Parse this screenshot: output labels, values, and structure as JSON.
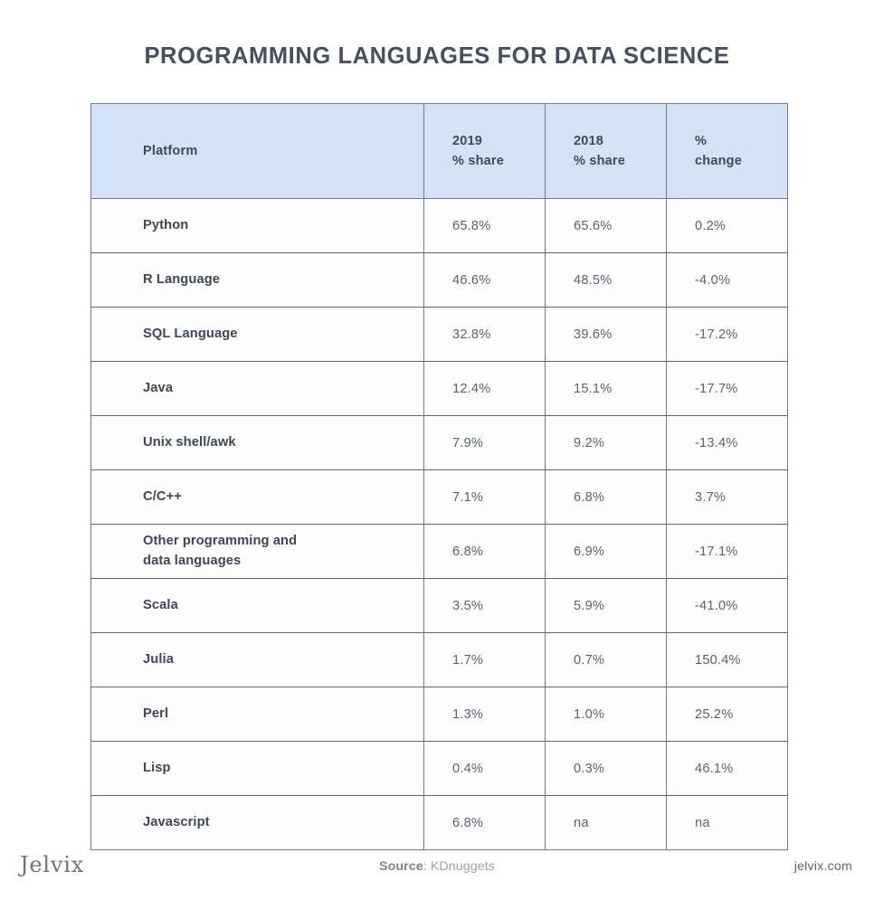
{
  "page": {
    "title": "PROGRAMMING LANGUAGES FOR DATA SCIENCE",
    "background_color": "#fefefe",
    "title_color": "#46505f"
  },
  "table": {
    "header_background": "#d3e3f5",
    "border_color": "#6f7a8a",
    "columns": [
      {
        "id": "platform",
        "line1": "Platform",
        "line2": ""
      },
      {
        "id": "share_2019",
        "line1": "2019",
        "line2": "% share"
      },
      {
        "id": "share_2018",
        "line1": "2018",
        "line2": "% share"
      },
      {
        "id": "change",
        "line1": "%",
        "line2": "change"
      }
    ],
    "rows": [
      {
        "platform_line1": "Python",
        "platform_line2": "",
        "share_2019": "65.8%",
        "share_2018": "65.6%",
        "change": "0.2%"
      },
      {
        "platform_line1": "R Language",
        "platform_line2": "",
        "share_2019": "46.6%",
        "share_2018": "48.5%",
        "change": "-4.0%"
      },
      {
        "platform_line1": "SQL Language",
        "platform_line2": "",
        "share_2019": "32.8%",
        "share_2018": "39.6%",
        "change": "-17.2%"
      },
      {
        "platform_line1": "Java",
        "platform_line2": "",
        "share_2019": "12.4%",
        "share_2018": "15.1%",
        "change": "-17.7%"
      },
      {
        "platform_line1": "Unix shell/awk",
        "platform_line2": "",
        "share_2019": "7.9%",
        "share_2018": "9.2%",
        "change": "-13.4%"
      },
      {
        "platform_line1": "C/C++",
        "platform_line2": "",
        "share_2019": "7.1%",
        "share_2018": "6.8%",
        "change": "3.7%"
      },
      {
        "platform_line1": "Other programming and",
        "platform_line2": "data languages",
        "share_2019": "6.8%",
        "share_2018": "6.9%",
        "change": "-17.1%"
      },
      {
        "platform_line1": "Scala",
        "platform_line2": "",
        "share_2019": "3.5%",
        "share_2018": "5.9%",
        "change": "-41.0%"
      },
      {
        "platform_line1": "Julia",
        "platform_line2": "",
        "share_2019": "1.7%",
        "share_2018": "0.7%",
        "change": "150.4%"
      },
      {
        "platform_line1": "Perl",
        "platform_line2": "",
        "share_2019": "1.3%",
        "share_2018": "1.0%",
        "change": "25.2%"
      },
      {
        "platform_line1": "Lisp",
        "platform_line2": "",
        "share_2019": "0.4%",
        "share_2018": "0.3%",
        "change": "46.1%"
      },
      {
        "platform_line1": "Javascript",
        "platform_line2": "",
        "share_2019": "6.8%",
        "share_2018": "na",
        "change": "na"
      }
    ]
  },
  "footer": {
    "logo_text": "Jelvix",
    "source_label": "Source",
    "source_separator": ": ",
    "source_value": "KDnuggets",
    "site_url": "jelvix.com"
  }
}
